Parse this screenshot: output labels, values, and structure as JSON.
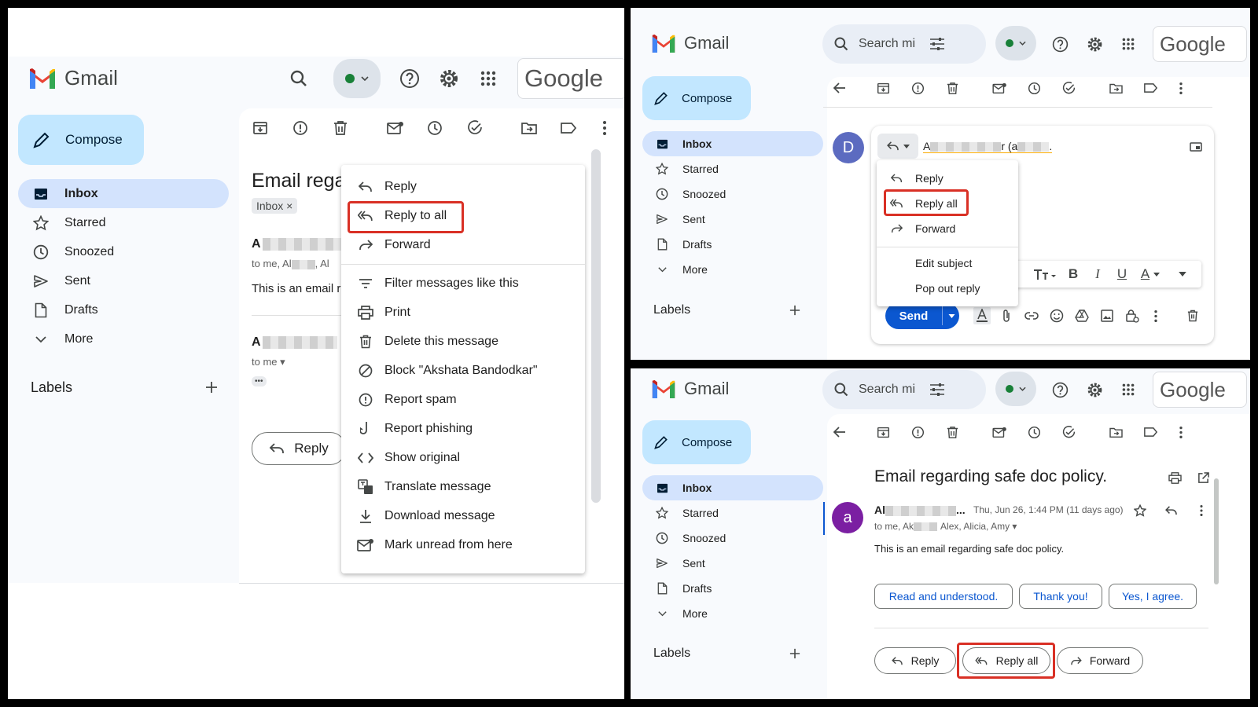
{
  "app_name": "Gmail",
  "brand": "Google",
  "compose": "Compose",
  "nav": [
    "Inbox",
    "Starred",
    "Snoozed",
    "Sent",
    "Drafts",
    "More"
  ],
  "labels": "Labels",
  "search_placeholder": "Search mi",
  "panel_a": {
    "subject": "Email rega",
    "inbox_chip": "Inbox ×",
    "sender1": "A",
    "to_line": "to me, Al",
    "to_line_b": ", Al",
    "snippet": "This is an email r",
    "sender2": "A",
    "to_me": "to me ▾",
    "ellipsis": "•••",
    "reply_button": "Reply",
    "menu": [
      "Reply",
      "Reply to all",
      "Forward",
      "Filter messages like this",
      "Print",
      "Delete this message",
      "Block \"Akshata Bandodkar\"",
      "Report spam",
      "Report phishing",
      "Show original",
      "Translate message",
      "Download message",
      "Mark unread from here"
    ]
  },
  "panel_b": {
    "avatar": "D",
    "recipient_a": "A",
    "recipient_b": "r (a",
    "recipient_c": ".",
    "menu": [
      "Reply",
      "Reply all",
      "Forward",
      "Edit subject",
      "Pop out reply"
    ],
    "send": "Send"
  },
  "panel_c": {
    "subject": "Email regarding safe doc policy.",
    "avatar": "a",
    "sender": "Al",
    "sender_tail": "...",
    "date": "Thu, Jun 26, 1:44 PM (11 days ago)",
    "to_line": "to me, Ak",
    "to_line_tail": "Alex, Alicia, Amy ▾",
    "body": "This is an email regarding safe doc policy.",
    "smart_replies": [
      "Read and understood.",
      "Thank you!",
      "Yes, I agree."
    ],
    "actions": [
      "Reply",
      "Reply all",
      "Forward"
    ]
  },
  "colors": {
    "highlight": "#d93025",
    "compose_bg": "#c2e7ff",
    "active_nav": "#d3e3fd",
    "send": "#0b57d0"
  }
}
